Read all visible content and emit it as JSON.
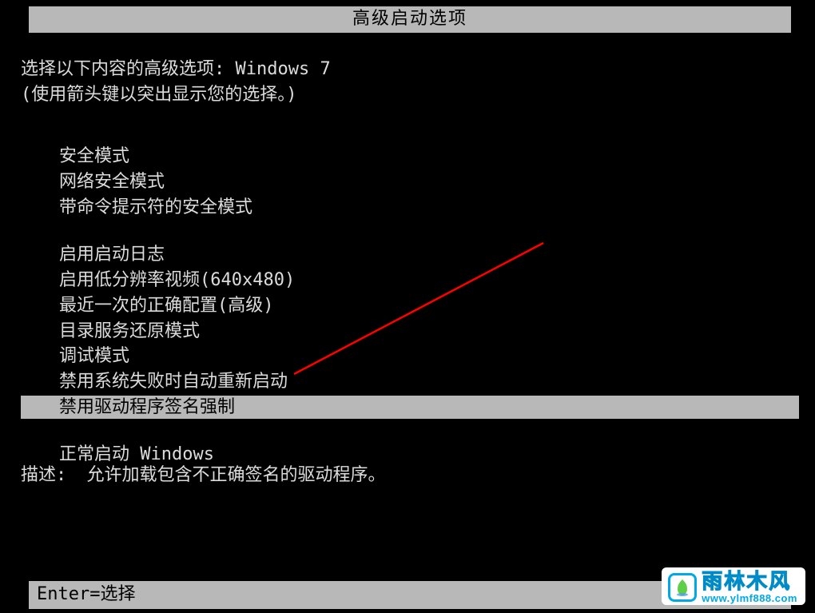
{
  "title": "高级启动选项",
  "intro": "选择以下内容的高级选项: Windows 7",
  "hint": "(使用箭头键以突出显示您的选择。)",
  "menu": {
    "group1": [
      "安全模式",
      "网络安全模式",
      "带命令提示符的安全模式"
    ],
    "group2": [
      "启用启动日志",
      "启用低分辨率视频(640x480)",
      "最近一次的正确配置(高级)",
      "目录服务还原模式",
      "调试模式",
      "禁用系统失败时自动重新启动",
      "禁用驱动程序签名强制"
    ],
    "group3": [
      "正常启动 Windows"
    ],
    "selected": "禁用驱动程序签名强制"
  },
  "description": {
    "label": "描述:",
    "text": "允许加载包含不正确签名的驱动程序。"
  },
  "footer": "Enter=选择",
  "watermark": {
    "name": "雨林木风",
    "url": "www.ylmf888.com"
  },
  "annotation": {
    "color": "#ff0000"
  }
}
